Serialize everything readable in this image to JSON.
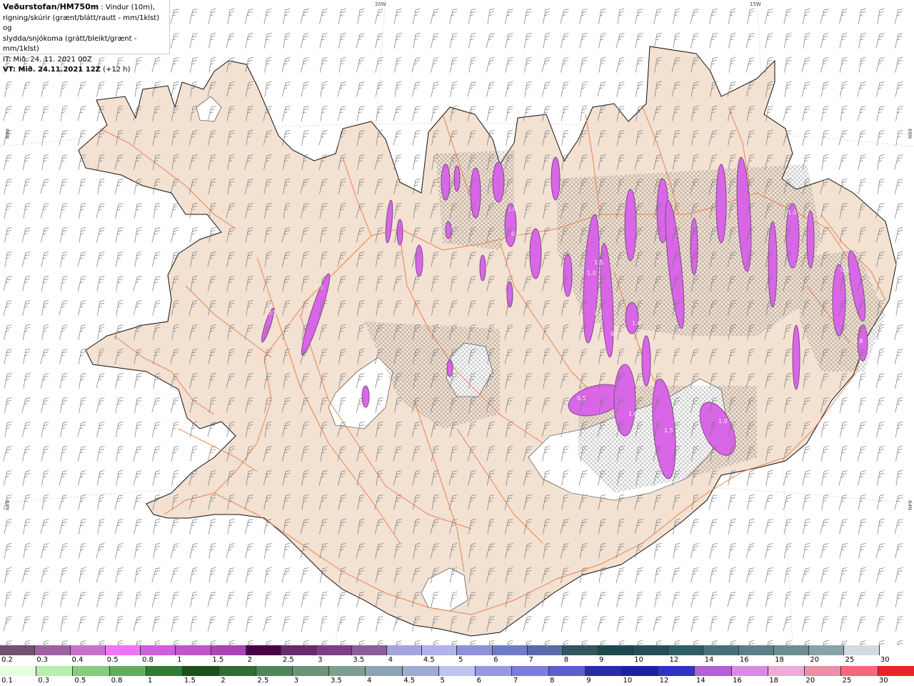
{
  "header": {
    "title": "Veðurstofan/HM750m",
    "line1_rest": " : Vindur (10m),",
    "line2": "rigning/skúrir (grænt/blátt/rautt - mm/1klst) og",
    "line3": "slydda/snjókoma (grátt/bleikt/grænt - mm/1klst)",
    "line4": "IT: Mið. 24. 11. 2021 00Z",
    "line5_bold": "VT: Mið. 24.11.2021 12Z",
    "line5_rest": " (+12 h)"
  },
  "map": {
    "lon_labels": [
      "20W",
      "15W"
    ],
    "lat_labels_left": [
      "66N",
      "64N"
    ],
    "lat_labels_right": [
      "66N",
      "64N"
    ],
    "precip_labels": [
      "0.5",
      "0.5",
      "1.0",
      "0.5",
      "2.1",
      "1.5",
      "0.8",
      "0.9",
      "1.0",
      "1.5",
      "1.0",
      "1.0",
      "1.0",
      "0.5",
      "0.8",
      "1.0",
      "0.5",
      "0.5"
    ],
    "colors": {
      "land": "#f3e1d2",
      "coast": "#111111",
      "roads": "#e8743a",
      "snow_purple": "#d966e6",
      "snow_dark": "#7b4b86",
      "glacier": "#ffffff",
      "barbs": "#777777"
    }
  },
  "legend": {
    "snow": {
      "labels": [
        "0.2",
        "0.3",
        "0.4",
        "0.5",
        "0.8",
        "1",
        "1.5",
        "2",
        "2.5",
        "3",
        "3.5",
        "4",
        "4.5",
        "5",
        "6",
        "7",
        "8",
        "9",
        "10",
        "12",
        "14",
        "16",
        "18",
        "20",
        "25",
        "30"
      ],
      "colors": [
        "#73506f",
        "#a061a4",
        "#c770cc",
        "#f075f4",
        "#d05fdd",
        "#bf55c9",
        "#aa45b3",
        "#4a0048",
        "#6a2a6e",
        "#7c3f86",
        "#8c5c9a",
        "#a6a4dd",
        "#b1b2ea",
        "#8d92d8",
        "#6e7cc6",
        "#5a6aa9",
        "#33555c",
        "#1b4a4d",
        "#244f58",
        "#2f5e67",
        "#49707a",
        "#5d8088",
        "#6d8d94",
        "#88a2a8",
        "#d4dadd",
        "#ffffff"
      ]
    },
    "rain": {
      "labels": [
        "0.1",
        "0.3",
        "0.5",
        "0.8",
        "1",
        "1.5",
        "2",
        "2.5",
        "3",
        "3.5",
        "4",
        "4.5",
        "5",
        "6",
        "7",
        "8",
        "9",
        "10",
        "12",
        "14",
        "16",
        "18",
        "20",
        "25",
        "30"
      ],
      "colors": [
        "#e5fde0",
        "#b8efb0",
        "#86cd7e",
        "#5fae5c",
        "#2d7e31",
        "#1b4f1c",
        "#2f6d33",
        "#4e8659",
        "#6b9479",
        "#7d9f91",
        "#8da2b4",
        "#9ea9d4",
        "#bfc3ef",
        "#9797e6",
        "#7b7be0",
        "#5c5ccf",
        "#2b2ba7",
        "#1f1fa0",
        "#3131c4",
        "#b35edb",
        "#d68be7",
        "#f2a9d6",
        "#f08ca8",
        "#f4687c",
        "#ee2222"
      ]
    }
  }
}
